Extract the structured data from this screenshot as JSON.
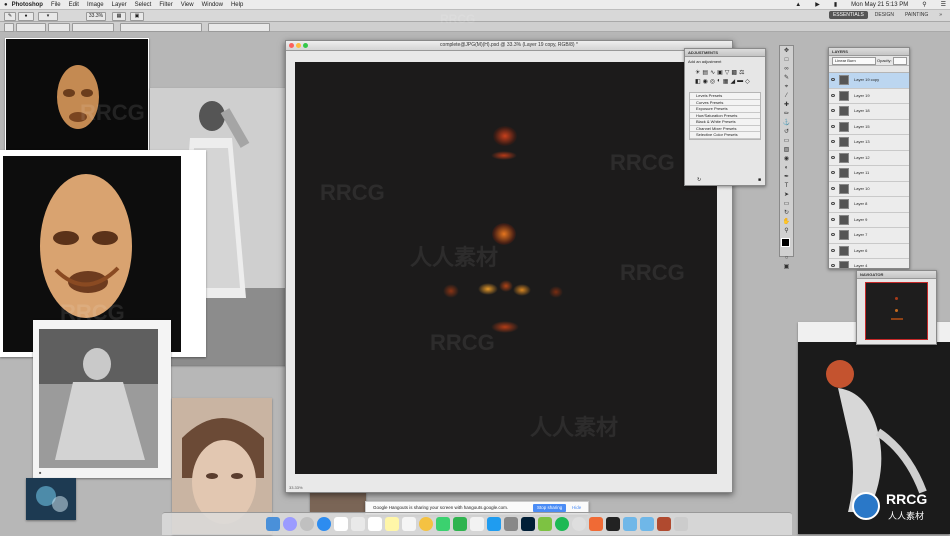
{
  "menubar": {
    "app": "Photoshop",
    "items": [
      "File",
      "Edit",
      "Image",
      "Layer",
      "Select",
      "Filter",
      "View",
      "Window",
      "Help"
    ],
    "clock": "Mon May 21  5:13 PM"
  },
  "options_bar": {
    "zoom": "33.3%",
    "workspaces": [
      "ESSENTIALS",
      "DESIGN",
      "PAINTING"
    ],
    "active_workspace": "ESSENTIALS"
  },
  "document": {
    "title": "complete@JPG(M)(H).psd @ 33.3% (Layer 19 copy, RGB/8) *",
    "zoom_status": "33.33%"
  },
  "adjustments": {
    "title": "ADJUSTMENTS",
    "subtitle": "Add an adjustment",
    "presets": [
      "Levels Presets",
      "Curves Presets",
      "Exposure Presets",
      "Hue/Saturation Presets",
      "Black & White Presets",
      "Channel Mixer Presets",
      "Selective Color Presets"
    ]
  },
  "layers": {
    "title": "LAYERS",
    "blend_mode": "Linear Burn",
    "opacity_label": "Opacity:",
    "items": [
      {
        "name": "Layer 19 copy",
        "selected": true
      },
      {
        "name": "Layer 19",
        "selected": false
      },
      {
        "name": "Layer 18",
        "selected": false
      },
      {
        "name": "Layer 15",
        "selected": false
      },
      {
        "name": "Layer 13",
        "selected": false
      },
      {
        "name": "Layer 12",
        "selected": false
      },
      {
        "name": "Layer 11",
        "selected": false
      },
      {
        "name": "Layer 10",
        "selected": false
      },
      {
        "name": "Layer 8",
        "selected": false
      },
      {
        "name": "Layer 9",
        "selected": false
      },
      {
        "name": "Layer 7",
        "selected": false
      },
      {
        "name": "Layer 6",
        "selected": false
      },
      {
        "name": "Layer 4",
        "selected": false
      }
    ]
  },
  "navigator": {
    "title": "NAVIGATOR",
    "zoom": "33.33%"
  },
  "banner": {
    "message": "Google Hangouts is sharing your screen with hangouts.google.com.",
    "stop": "Stop sharing",
    "hide": "Hide"
  },
  "watermarks": [
    "RRCG",
    "人人素材"
  ],
  "logo": {
    "mark": "RRCG",
    "sub": "人人素材"
  }
}
